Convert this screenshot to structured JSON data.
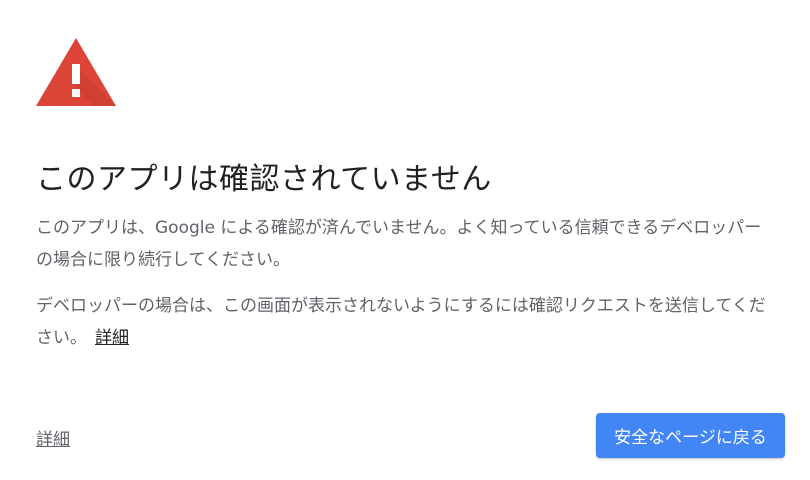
{
  "warning": {
    "icon": "warning-triangle-icon",
    "color": "#db4437",
    "shadow_color": "#c43c2f",
    "glyph_color": "#ffffff"
  },
  "title": "このアプリは確認されていません",
  "paragraphs": {
    "p1": "このアプリは、Google による確認が済んでいません。よく知っている信頼できるデベロッパーの場合に限り続行してください。",
    "p2": "デベロッパーの場合は、この画面が表示されないようにするには確認リクエストを送信してください。",
    "p2_link": "詳細"
  },
  "footer": {
    "details_link": "詳細",
    "back_button": "安全なページに戻る"
  },
  "colors": {
    "button_bg": "#4285f4",
    "title_text": "#202124",
    "body_text": "#5f6368"
  }
}
